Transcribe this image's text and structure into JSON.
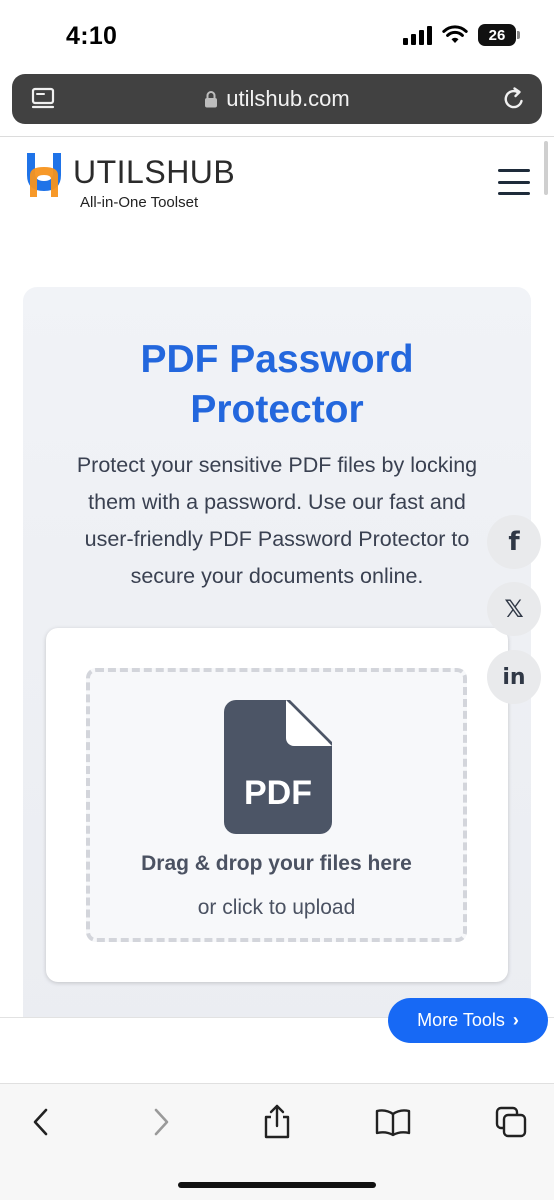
{
  "status_bar": {
    "time": "4:10",
    "battery_level": "26",
    "signal_icon": "cellular-signal-icon",
    "wifi_icon": "wifi-icon"
  },
  "browser": {
    "url": "utilshub.com",
    "lock_icon": "lock-icon",
    "reader_icon": "page-menu-icon",
    "reload_icon": "reload-icon"
  },
  "site": {
    "logo_text": "UTILSHUB",
    "tagline": "All-in-One Toolset",
    "menu_icon": "hamburger-menu-icon"
  },
  "hero": {
    "title_line1": "PDF Password",
    "title_line2": "Protector",
    "description_lines": [
      "Protect your sensitive PDF files by locking",
      "them with a password. Use our fast and",
      "user-friendly PDF Password Protector to",
      "secure your documents online."
    ]
  },
  "upload": {
    "file_icon_label": "PDF",
    "drop_text": "Drag & drop your files here",
    "click_text": "or click to upload"
  },
  "social": {
    "facebook_glyph": "f",
    "x_glyph": "𝕏",
    "linkedin_glyph": "in"
  },
  "floating": {
    "more_tools_label": "More Tools",
    "more_tools_chevron": "›"
  },
  "colors": {
    "title_blue": "#2367dd",
    "button_blue": "#1769f5",
    "logo_blue": "#1f73e8",
    "logo_orange": "#f7941d",
    "icon_dark": "#4c5566"
  }
}
